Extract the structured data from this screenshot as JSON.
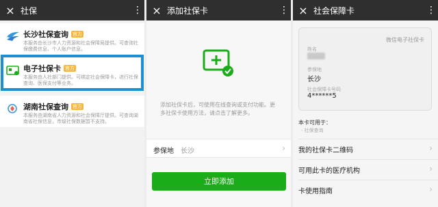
{
  "panel1": {
    "title": "社保",
    "services": [
      {
        "name": "长沙社保查询",
        "badge": "官方",
        "desc": "本服务由长沙市人力资源和社会保障局提供。可查询社保缴费信息、个人账户信息。"
      },
      {
        "name": "电子社保卡",
        "badge": "官方",
        "desc": "本服务由人社部门提供。可绑定社会保障卡，进行社保查询、医保支付等业务。"
      },
      {
        "name": "湖南社保查询",
        "badge": "官方",
        "desc": "本服务由湖南省人力资源和社会保障厅提供。可查询湖南省社保信息，市级社保数据暂不支持。"
      }
    ]
  },
  "panel2": {
    "title": "添加社保卡",
    "message": "添加社保卡后，可使用在线查询或支付功能。更多社保卡使用方法，请点击了解更多。",
    "field_label": "参保地",
    "field_value": "长沙",
    "button": "立即添加"
  },
  "panel3": {
    "title": "社会保障卡",
    "card": {
      "brand": "微信电子社保卡",
      "name_label": "姓名",
      "place_label": "参保地",
      "place": "长沙",
      "number_label": "社会保障卡号码",
      "number": "4******5"
    },
    "usable_title": "本卡可用于：",
    "usable_item": "· 社保查询",
    "menu": [
      "我的社保卡二维码",
      "可用此卡的医疗机构",
      "卡使用指南"
    ]
  },
  "icons": {
    "close": "×",
    "more": "⋮",
    "arrow": "›"
  },
  "colors": {
    "accent_green": "#1aad19",
    "highlight_blue": "#1c8ed6",
    "badge_orange": "#f6b73c",
    "topbar": "#2f2f2f"
  }
}
